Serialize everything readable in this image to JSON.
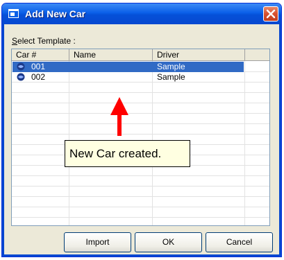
{
  "window": {
    "title": "Add New Car",
    "close_icon": "close-icon"
  },
  "select_label": {
    "accel": "S",
    "rest": "elect Template :"
  },
  "table": {
    "columns": [
      "Car #",
      "Name",
      "Driver"
    ],
    "rows": [
      {
        "car": "001",
        "name": "",
        "driver": "Sample",
        "selected": true
      },
      {
        "car": "002",
        "name": "",
        "driver": "Sample",
        "selected": false
      }
    ]
  },
  "tooltip": {
    "text": "New Car created."
  },
  "buttons": {
    "import": "Import",
    "ok": "OK",
    "cancel": "Cancel"
  },
  "colors": {
    "selection": "#316ac5",
    "annotation_arrow": "#ff0000",
    "title_bar": "#0a5fe8"
  }
}
